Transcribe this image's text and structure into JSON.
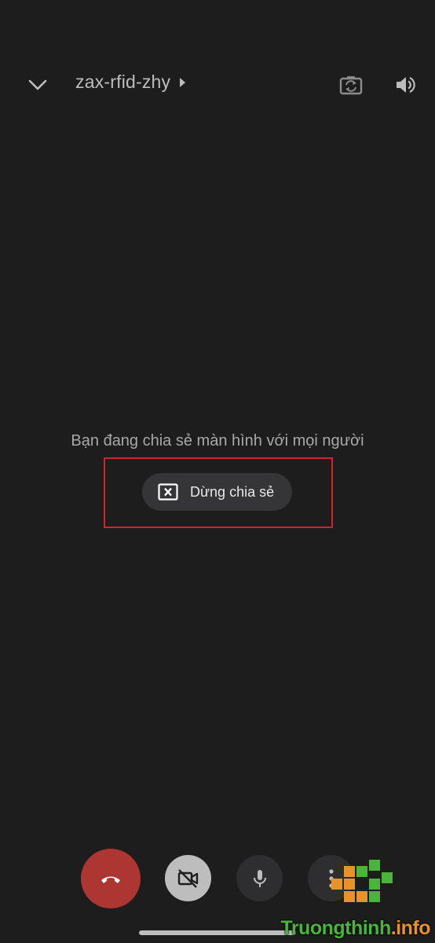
{
  "header": {
    "meeting_code": "zax-rfid-zhy"
  },
  "main": {
    "share_message": "Bạn đang chia sẻ màn hình với mọi người",
    "stop_share_label": "Dừng chia sẻ"
  },
  "controls": {
    "hangup_icon": "phone-hangup-icon",
    "video_icon": "video-off-icon",
    "mic_icon": "mic-icon",
    "more_icon": "more-vert-icon"
  },
  "watermark": {
    "text_main": "Truongthinh",
    "text_suffix": ".info"
  },
  "colors": {
    "background": "#1d1d1e",
    "hangup": "#ad3633",
    "highlight_border": "#d6212e",
    "watermark_green": "#4ab43c",
    "watermark_orange": "#e8922a"
  }
}
